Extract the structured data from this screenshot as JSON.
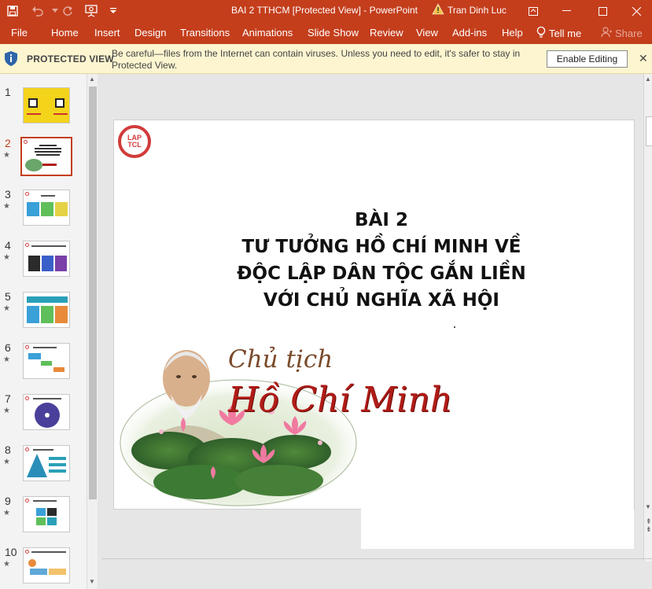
{
  "window": {
    "title": "BAI 2 TTHCM [Protected View]  -  PowerPoint",
    "user": "Tran Dinh Luc"
  },
  "ribbon": {
    "tabs": [
      "File",
      "Home",
      "Insert",
      "Design",
      "Transitions",
      "Animations",
      "Slide Show",
      "Review",
      "View",
      "Add-ins",
      "Help"
    ],
    "tell_me": "Tell me",
    "share": "Share"
  },
  "protected_bar": {
    "label": "PROTECTED VIEW",
    "message": "Be careful—files from the Internet can contain viruses. Unless you need to edit, it's safer to stay in Protected View.",
    "enable_button": "Enable Editing"
  },
  "thumbnails": {
    "numbers": [
      "1",
      "2",
      "3",
      "4",
      "5",
      "6",
      "7",
      "8",
      "9",
      "10"
    ],
    "selected": "2"
  },
  "slide": {
    "logo_line1": "LAP",
    "logo_line2": "TCL",
    "title_lines": [
      "BÀI 2",
      "TƯ TƯỞNG HỒ CHÍ MINH VỀ",
      "ĐỘC LẬP DÂN TỘC GẮN LIỀN",
      "VỚI CHỦ NGHĨA XÃ HỘI"
    ],
    "caption_line1": "Chủ tịch",
    "caption_line2": "Hồ Chí Minh"
  },
  "colors": {
    "accent": "#c43e1c",
    "protected_bg": "#fcf5d0",
    "caption_red": "#b11c17"
  }
}
